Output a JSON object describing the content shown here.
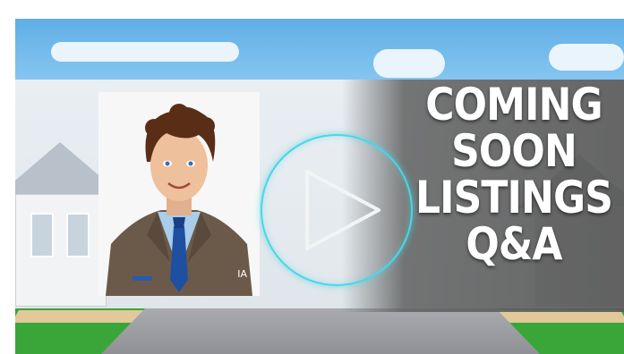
{
  "thumbnail": {
    "title_lines": [
      "COMING",
      "SOON",
      "LISTINGS",
      "Q&A"
    ],
    "portrait_initials": "IA",
    "play_icon": "play-icon",
    "colors": {
      "play_ring": "#49d6e6",
      "overlay": "#5f5f5f",
      "title_text": "#ffffff",
      "sky": "#5faee6",
      "suit": "#6b5a4a",
      "tie": "#1f4fa0",
      "shirt": "#a9cdea"
    }
  }
}
